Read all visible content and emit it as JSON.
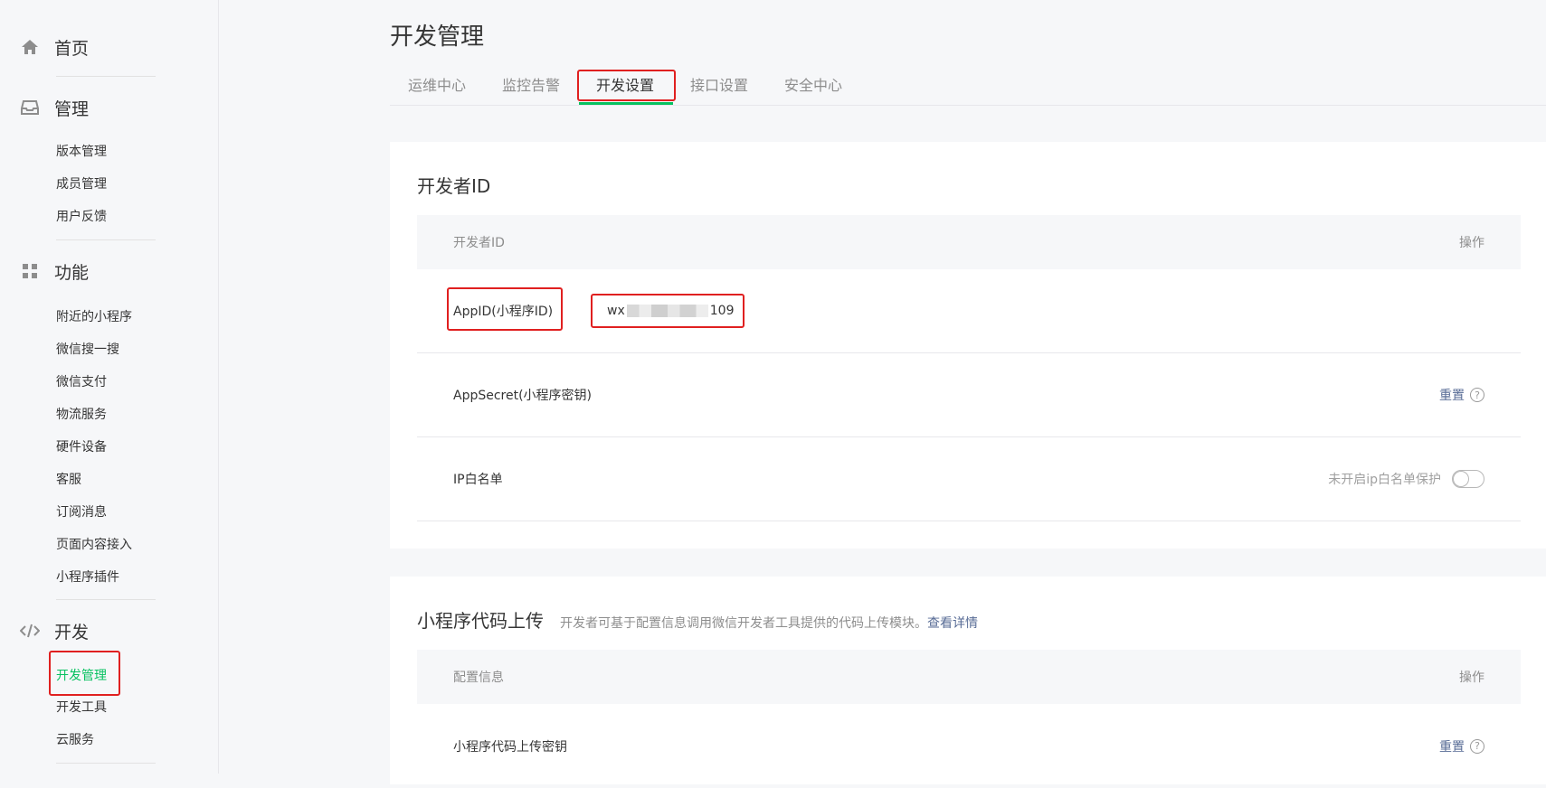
{
  "sidebar": {
    "home": {
      "label": "首页",
      "icon": "home-icon"
    },
    "manage": {
      "label": "管理",
      "icon": "inbox-icon",
      "items": [
        "版本管理",
        "成员管理",
        "用户反馈"
      ]
    },
    "features": {
      "label": "功能",
      "icon": "grid-icon",
      "items": [
        "附近的小程序",
        "微信搜一搜",
        "微信支付",
        "物流服务",
        "硬件设备",
        "客服",
        "订阅消息",
        "页面内容接入",
        "小程序插件"
      ]
    },
    "develop": {
      "label": "开发",
      "icon": "code-icon",
      "items": [
        "开发管理",
        "开发工具",
        "云服务"
      ],
      "active": "开发管理"
    }
  },
  "page": {
    "title": "开发管理"
  },
  "tabs": [
    {
      "label": "运维中心"
    },
    {
      "label": "监控告警"
    },
    {
      "label": "开发设置",
      "active": true
    },
    {
      "label": "接口设置"
    },
    {
      "label": "安全中心"
    }
  ],
  "developer_id": {
    "title": "开发者ID",
    "table_header": {
      "col1": "开发者ID",
      "col2": "操作"
    },
    "appid": {
      "label": "AppID(小程序ID)",
      "value_prefix": "wx",
      "value_suffix": "109"
    },
    "appsecret": {
      "label": "AppSecret(小程序密钥)",
      "action": "重置"
    },
    "ip_whitelist": {
      "label": "IP白名单",
      "status": "未开启ip白名单保护",
      "enabled": false
    }
  },
  "code_upload": {
    "title": "小程序代码上传",
    "desc": "开发者可基于配置信息调用微信开发者工具提供的代码上传模块。",
    "link": "查看详情",
    "table_header": {
      "col1": "配置信息",
      "col2": "操作"
    },
    "key_row": {
      "label": "小程序代码上传密钥",
      "action": "重置"
    }
  },
  "colors": {
    "accent": "#07c160",
    "link": "#576b95",
    "highlight": "#e02020"
  }
}
